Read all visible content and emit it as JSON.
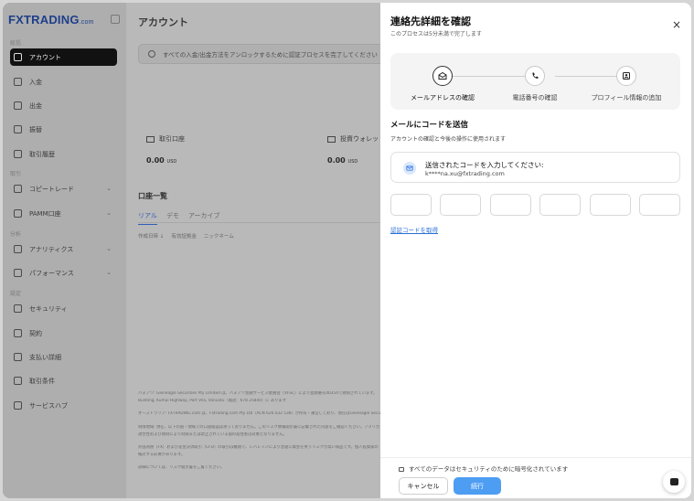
{
  "colors": {
    "accent": "#4d9df2",
    "link": "#2a6fd6",
    "brand": "#1e3f8a"
  },
  "sidebar": {
    "logo_main": "FXTRADING",
    "logo_suffix": ".com",
    "sections": [
      "総括",
      "取引",
      "分析",
      "設定"
    ],
    "items": [
      {
        "label": "アカウント",
        "icon": "dashboard-icon",
        "active": true
      },
      {
        "label": "入金",
        "icon": "deposit-icon"
      },
      {
        "label": "出金",
        "icon": "withdraw-icon"
      },
      {
        "label": "振替",
        "icon": "transfer-icon"
      },
      {
        "label": "取引履歴",
        "icon": "history-icon"
      },
      {
        "label": "コピートレード",
        "icon": "copy-trade-icon",
        "chevron": "⌄"
      },
      {
        "label": "PAMM口座",
        "icon": "pamm-icon",
        "chevron": "⌄"
      },
      {
        "label": "アナリティクス",
        "icon": "analytics-icon",
        "chevron": "⌄"
      },
      {
        "label": "パフォーマンス",
        "icon": "performance-icon",
        "chevron": "⌄"
      },
      {
        "label": "セキュリティ",
        "icon": "shield-icon"
      },
      {
        "label": "契約",
        "icon": "contract-icon"
      },
      {
        "label": "支払い詳細",
        "icon": "payment-icon"
      },
      {
        "label": "取引条件",
        "icon": "conditions-icon"
      },
      {
        "label": "サービスハブ",
        "icon": "service-hub-icon"
      }
    ]
  },
  "main": {
    "title": "アカウント",
    "banner": "すべての入金/出金方法をアンロックするために認証プロセスを完了してください",
    "cards": [
      {
        "label": "取引口座",
        "value": "0.00",
        "unit": "USD"
      },
      {
        "label": "投資ウォレット",
        "value": "0.00",
        "unit": "USD"
      }
    ],
    "accounts_title": "口座一覧",
    "tabs": [
      "リアル",
      "デモ",
      "アーカイブ"
    ],
    "sort": [
      "作成日時 ↓",
      "有効証拠金",
      "ニックネーム"
    ],
    "footer": [
      "バヌアツ: Gleneagle Securities Pty Limited は、バヌアツ金融サービス委員会（VFSC）により登録番号40354で規制されています。",
      "Building, Kumul Highway, Port Vila, Vanuatu（電話：678 25840）に あります",
      "オーストラリア: FXTRADING.com は、Fxtrading.com Pty Ltd（ACN 626 032 538）が所有・運営しており、現在はGleneagle Securitiesの",
      "制限地域: 現在、以下の国・地域での口座開設は承っておりません。このリスク情報開示書に記載された内容をご確認ください。アメリカ",
      "適合性および規制により制限または禁止されている国の居住者は対象となりません。",
      "外国為替（FX）および差金決済取引（CFD）の取引は複雑で、レバレッジにより急速に資金を失うリスクが高い商品です。個人投資家の",
      "検討する必要があります。",
      "詳細については、リスク開示書をご覧ください。"
    ]
  },
  "modal": {
    "title": "連絡先詳細を確認",
    "subtitle": "このプロセスは5分未満で完了します",
    "close": "×",
    "steps": [
      {
        "label": "メールアドレスの確認",
        "icon": "mail-icon",
        "active": true
      },
      {
        "label": "電話番号の確認",
        "icon": "phone-icon"
      },
      {
        "label": "プロフィール情報の追加",
        "icon": "profile-icon"
      }
    ],
    "section_title": "メールにコードを送信",
    "section_desc": "アカウントの確認と今後の操作に使用されます",
    "sent_title": "送信されたコードを入力してください:",
    "sent_email": "k****na.xu@fxtrading.com",
    "code_values": [
      "",
      "",
      "",
      "",
      "",
      ""
    ],
    "get_code": "認証コードを取得",
    "secure_note": "すべてのデータはセキュリティのために暗号化されています",
    "cancel": "キャンセル",
    "next": "続行"
  }
}
